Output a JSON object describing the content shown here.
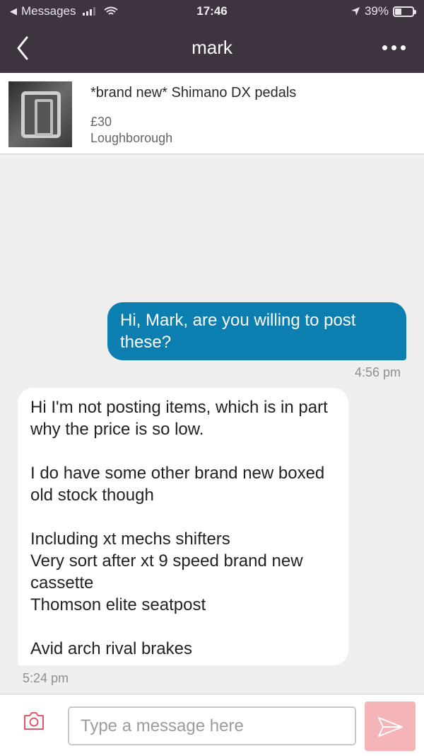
{
  "status_bar": {
    "back_app": "Messages",
    "time": "17:46",
    "battery": "39%",
    "battery_level": 0.39
  },
  "nav": {
    "title": "mark"
  },
  "listing": {
    "name": "*brand new* Shimano DX pedals",
    "price": "£30",
    "location": "Loughborough"
  },
  "messages": [
    {
      "direction": "outgoing",
      "text": "Hi, Mark, are you willing to post these?",
      "time": "4:56 pm"
    },
    {
      "direction": "incoming",
      "paragraphs": [
        "Hi I'm not posting items, which is in part why the price is so low.",
        "I do have some other brand new boxed old stock though",
        "Including xt mechs shifters\nVery sort after xt 9 speed brand new cassette\nThomson elite seatpost",
        "Avid arch rival brakes"
      ],
      "time": "5:24 pm"
    }
  ],
  "composer": {
    "placeholder": "Type a message here"
  },
  "colors": {
    "header_bg": "#3e3440",
    "outgoing_bubble": "#0c7eb0",
    "send_button": "#f4b4b8",
    "camera_icon": "#e05a66"
  }
}
